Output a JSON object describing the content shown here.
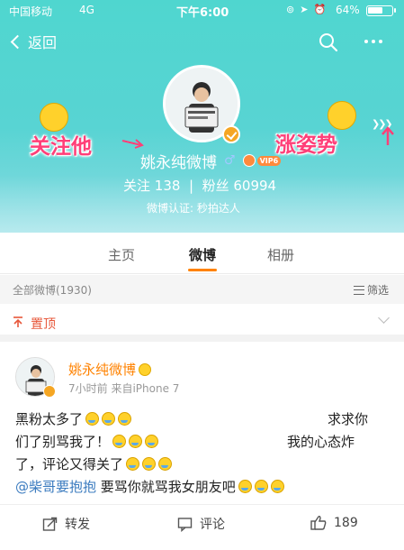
{
  "status_bar": {
    "carrier": "中国移动",
    "network": "4G",
    "time": "下午6:00",
    "battery": "64%",
    "battery_level": 0.64
  },
  "nav": {
    "back_label": "返回"
  },
  "profile": {
    "name": "姚永纯微博",
    "vip_badge": "VIP6",
    "following_label": "关注",
    "following_count": "138",
    "followers_label": "粉丝",
    "followers_count": "60994",
    "certification": "微博认证: 秒拍达人"
  },
  "annotations": {
    "left": "关注他",
    "right": "涨姿势"
  },
  "tabs": [
    {
      "label": "主页"
    },
    {
      "label": "微博"
    },
    {
      "label": "相册"
    }
  ],
  "feed": {
    "all_label": "全部微博(1930)",
    "filter_label": "筛选",
    "pinned_label": "置顶"
  },
  "post": {
    "author": "姚永纯微博",
    "time": "7小时前",
    "source": "来自iPhone 7",
    "line1_a": "黑粉太多了",
    "line1_b": "求求你",
    "line2_a": "们了别骂我了！",
    "line2_b": "我的心态炸",
    "line3": "了，评论又得关了",
    "mention": "@柴哥要抱抱",
    "line4": " 要骂你就骂我女朋友吧"
  },
  "actions": {
    "repost": "转发",
    "comment": "评论",
    "likes": "189"
  },
  "colors": {
    "header_teal": "#56d4d0",
    "accent_orange": "#ff8200",
    "annotation_pink": "#ff3f78",
    "pin_red": "#e7573a",
    "link_blue": "#3b7bbf"
  }
}
